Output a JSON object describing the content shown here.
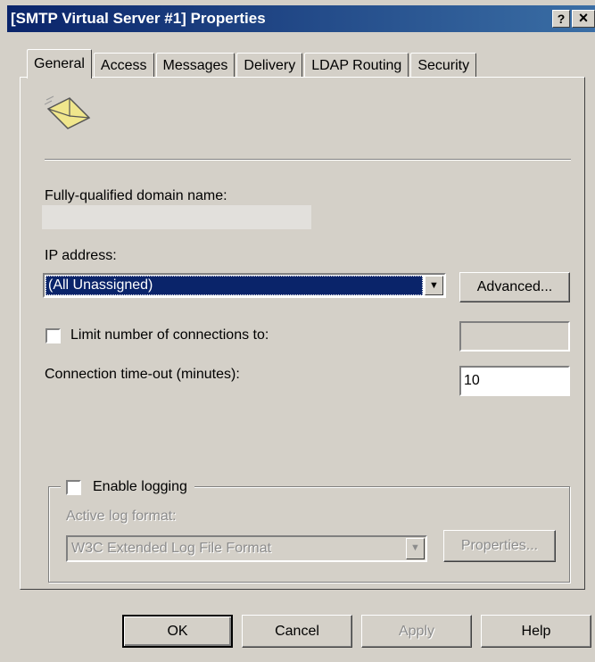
{
  "window": {
    "title": "[SMTP Virtual Server #1] Properties"
  },
  "titlebar_buttons": {
    "help": "?",
    "close": "×"
  },
  "tabs": [
    {
      "label": "General",
      "active": true
    },
    {
      "label": "Access"
    },
    {
      "label": "Messages"
    },
    {
      "label": "Delivery"
    },
    {
      "label": "LDAP Routing"
    },
    {
      "label": "Security"
    }
  ],
  "general": {
    "fqdn_label": "Fully-qualified domain name:",
    "fqdn_value": "",
    "ip_label": "IP address:",
    "ip_value": "(All Unassigned)",
    "advanced_button": "Advanced...",
    "limit_connections_label": "Limit number of connections to:",
    "limit_connections_checked": false,
    "limit_connections_value": "",
    "timeout_label": "Connection time-out (minutes):",
    "timeout_value": "10",
    "logging": {
      "enable_label": "Enable logging",
      "enabled": false,
      "format_label": "Active log format:",
      "format_value": "W3C Extended Log File Format",
      "properties_button": "Properties..."
    }
  },
  "footer": {
    "ok": "OK",
    "cancel": "Cancel",
    "apply": "Apply",
    "help": "Help"
  },
  "icons": {
    "app_icon": "envelope-icon",
    "dropdown": "chevron-down-icon"
  },
  "colors": {
    "titlebar": "#0a246a",
    "selection": "#0a246a",
    "dialog_bg": "#d4d0c8"
  }
}
